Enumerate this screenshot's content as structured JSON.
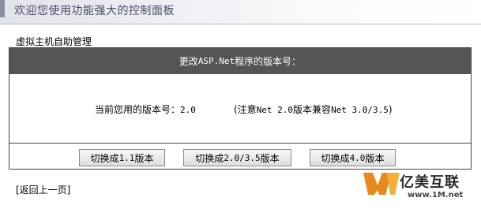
{
  "header": {
    "title": "欢迎您使用功能强大的控制面板"
  },
  "section": {
    "title": "虚拟主机自助管理"
  },
  "panel": {
    "heading_prefix": "更改",
    "heading_tech": "ASP.Net",
    "heading_suffix": "程序的版本号：",
    "current_label": "当前您用的版本号：",
    "current_value": "2.0",
    "note_open": "(注意",
    "note_tech": "Net 2.0",
    "note_mid": "版本兼容",
    "note_compat": "Net 3.0/3.5",
    "note_close": ")"
  },
  "buttons": [
    {
      "prefix": "切换成",
      "version": "1.1",
      "suffix": "版本"
    },
    {
      "prefix": "切换成",
      "version": "2.0/3.5",
      "suffix": "版本"
    },
    {
      "prefix": "切换成",
      "version": "4.0",
      "suffix": "版本"
    }
  ],
  "back_link": "[返回上一页]",
  "logo": {
    "name": "亿美互联",
    "url": "www.1M.net",
    "colors": {
      "primary": "#e58a1f",
      "secondary": "#f2b03a"
    }
  },
  "colors": {
    "panel_header_bg": "#555555",
    "header_text": "#4a4f66"
  }
}
